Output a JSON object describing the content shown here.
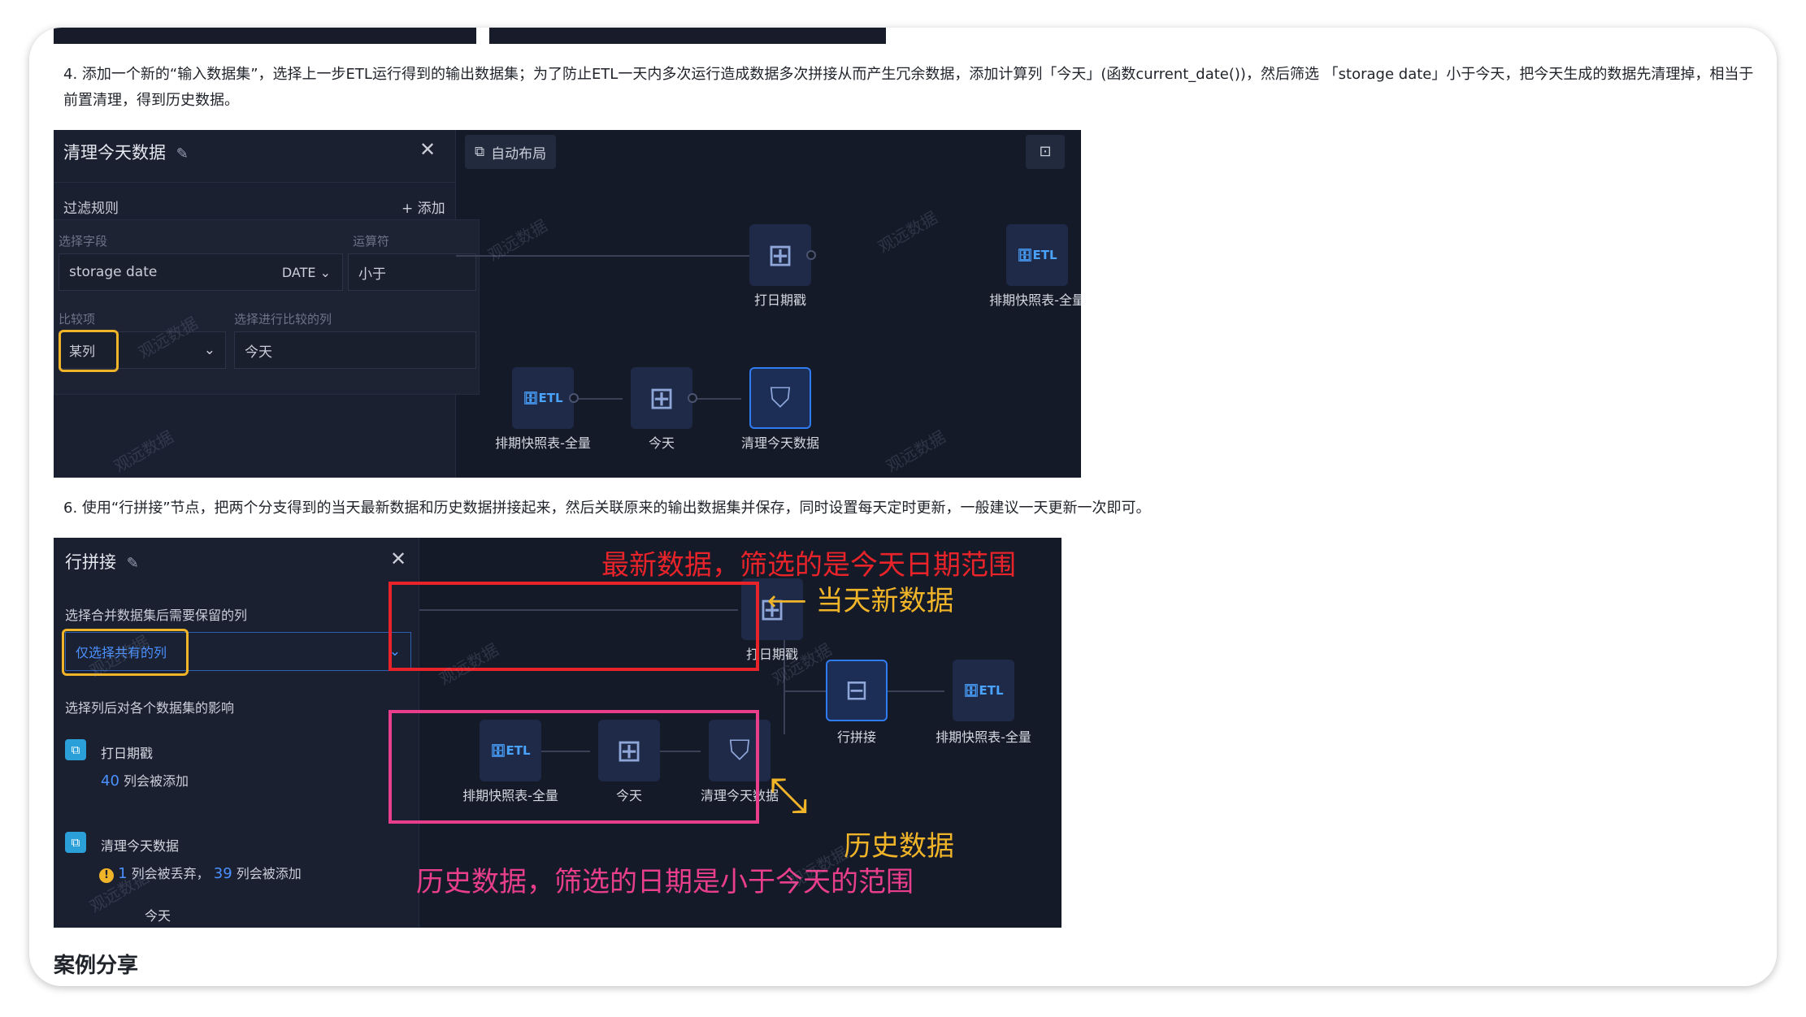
{
  "step4": {
    "text": "4. 添加一个新的“输入数据集”，选择上一步ETL运行得到的输出数据集；为了防止ETL一天内多次运行造成数据多次拼接从而产生冗余数据，添加计算列「今天」(函数current_date())，然后筛选 「storage date」小于今天，把今天生成的数据先清理掉，相当于前置清理，得到历史数据。"
  },
  "shot1": {
    "panel_title": "清理今天数据",
    "filter_rules": "过滤规则",
    "add": "+ 添加",
    "field_label": "选择字段",
    "operator_label": "运算符",
    "field_value": "storage date",
    "field_type": "DATE",
    "operator_value": "小于",
    "compare_label": "比较项",
    "compare_col_label": "选择进行比较的列",
    "compare_value": "某列",
    "compare_col_value": "今天",
    "auto_layout": "自动布局",
    "nodes": {
      "stamp": "打日期戳",
      "snapshot_out": "排期快照表-全量",
      "snapshot_in": "排期快照表-全量",
      "today": "今天",
      "clean": "清理今天数据"
    },
    "watermark": "观远数据"
  },
  "step6": {
    "text": "6. 使用“行拼接”节点，把两个分支得到的当天最新数据和历史数据拼接起来，然后关联原来的输出数据集并保存，同时设置每天定时更新，一般建议一天更新一次即可。"
  },
  "shot2": {
    "panel_title": "行拼接",
    "keep_cols_label": "选择合并数据集后需要保留的列",
    "keep_cols_value": "仅选择共有的列",
    "impact_label": "选择列后对各个数据集的影响",
    "ds1_name": "打日期戳",
    "ds1_count": "40",
    "ds1_suffix": "列会被添加",
    "ds2_name": "清理今天数据",
    "ds2_drop": "1",
    "ds2_drop_suffix": "列会被丢弃，",
    "ds2_add": "39",
    "ds2_add_suffix": "列会被添加",
    "ds3_name": "今天",
    "nodes": {
      "stamp": "打日期戳",
      "union": "行拼接",
      "snapshot_out": "排期快照表-全量",
      "snapshot_in": "排期快照表-全量",
      "today": "今天",
      "clean": "清理今天数据"
    },
    "annot_latest": "最新数据，筛选的是今天日期范围",
    "annot_new": "当天新数据",
    "annot_hist": "历史数据",
    "annot_hist_range": "历史数据，筛选的日期是小于今天的范围",
    "watermark": "观远数据"
  },
  "case_share": "案例分享",
  "colors": {
    "red": "#e8232a",
    "pink": "#e83e8c",
    "orange": "#f0b429",
    "node_blue": "#2f7bf0"
  }
}
